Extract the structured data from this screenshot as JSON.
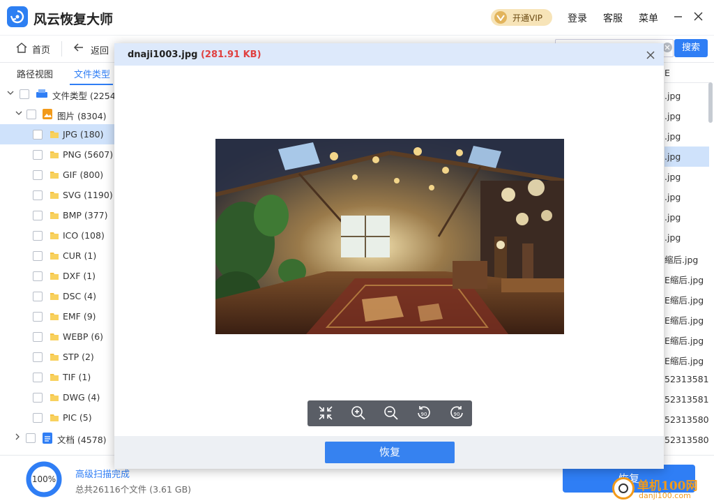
{
  "app": {
    "title": "风云恢复大师"
  },
  "header": {
    "vip_label": "开通VIP",
    "login": "登录",
    "service": "客服",
    "menu": "菜单"
  },
  "toolbar": {
    "home": "首页",
    "back": "返回",
    "search_button": "搜索"
  },
  "tabs": [
    {
      "label": "路径视图"
    },
    {
      "label": "文件类型"
    }
  ],
  "tree": {
    "root": {
      "label": "文件类型 (22546"
    },
    "images": {
      "label": "图片 (8304)"
    },
    "items": [
      {
        "label": "JPG (180)"
      },
      {
        "label": "PNG (5607)"
      },
      {
        "label": "GIF (800)"
      },
      {
        "label": "SVG (1190)"
      },
      {
        "label": "BMP (377)"
      },
      {
        "label": "ICO (108)"
      },
      {
        "label": "CUR (1)"
      },
      {
        "label": "DXF (1)"
      },
      {
        "label": "DSC (4)"
      },
      {
        "label": "EMF (9)"
      },
      {
        "label": "WEBP (6)"
      },
      {
        "label": "STP (2)"
      },
      {
        "label": "TIF (1)"
      },
      {
        "label": "DWG (4)"
      },
      {
        "label": "PIC (5)"
      }
    ],
    "documents": {
      "label": "文档 (4578)"
    }
  },
  "file_list": {
    "header_fragment": "E",
    "rows": [
      ".jpg",
      ".jpg",
      ".jpg",
      ".jpg",
      ".jpg",
      ".jpg",
      ".jpg",
      ".jpg",
      "缩后.jpg",
      "E缩后.jpg",
      "E缩后.jpg",
      "E缩后.jpg",
      "E缩后.jpg",
      "E缩后.jpg",
      "52313581.",
      "52313581.",
      "52313580.",
      "52313580."
    ]
  },
  "footer": {
    "progress": "100%",
    "progress_value": 1.0,
    "scan_status": "高级扫描完成",
    "summary": "总共26116个文件 (3.61 GB)",
    "recover": "恢复"
  },
  "watermark": {
    "name": "单机100网",
    "url": "danji100.com"
  },
  "preview_modal": {
    "filename": "dnaji1003.jpg",
    "filesize": "(281.91 KB)",
    "recover_button": "恢复",
    "tools": [
      "fit-screen",
      "zoom-in",
      "zoom-out",
      "rotate-left-90",
      "rotate-right-90"
    ],
    "tool_labels": {
      "rotate_left": "90",
      "rotate_right": "90"
    }
  },
  "colors": {
    "accent": "#2f7ef5",
    "error": "#e04040",
    "vip": "#f7e4b8"
  }
}
